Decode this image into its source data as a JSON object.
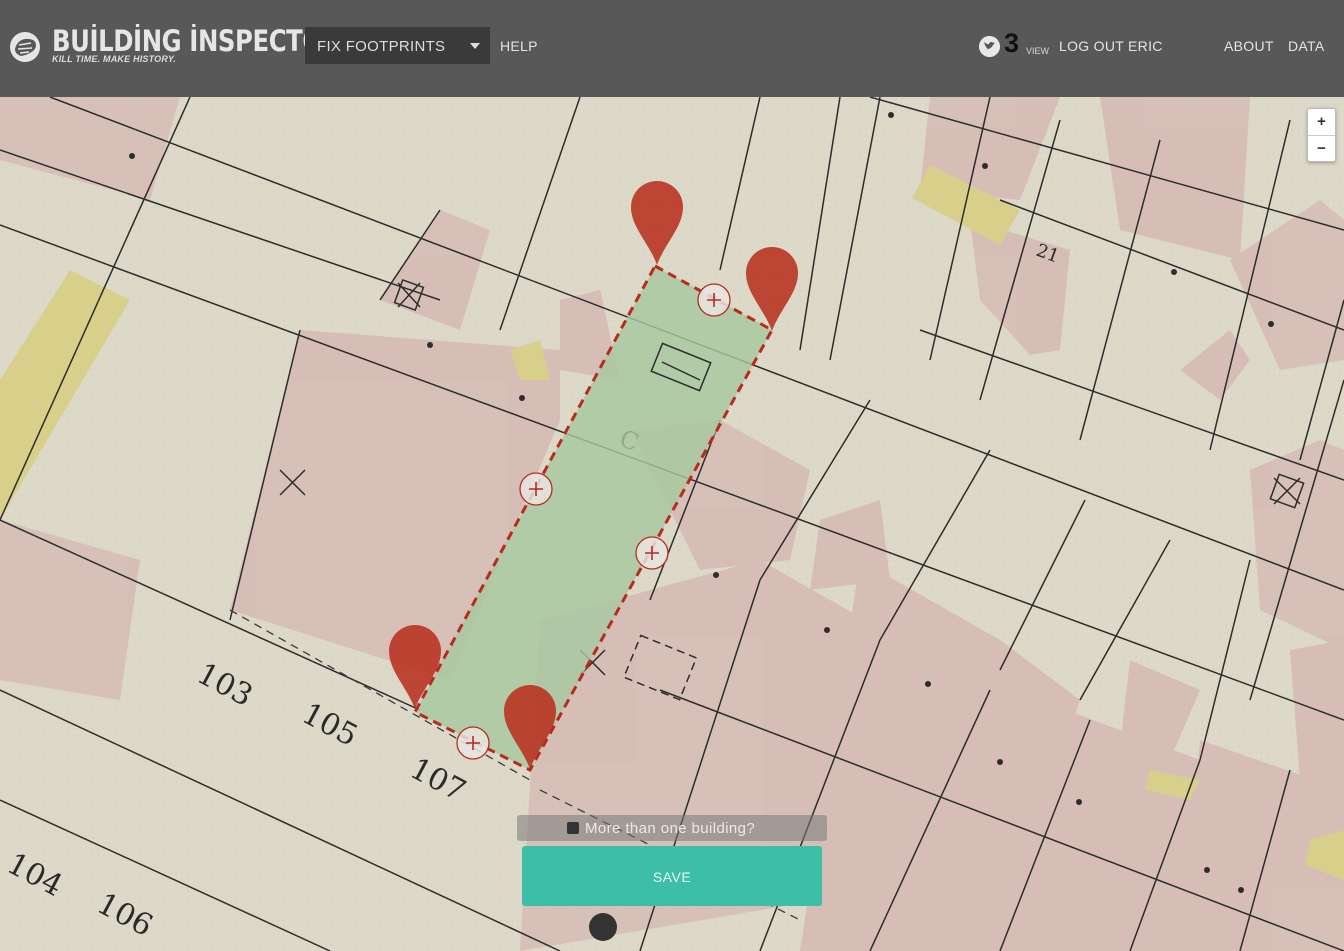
{
  "header": {
    "logo_title": "BUİLDİNG İNSPECTOR",
    "logo_tagline": "KILL TIME. MAKE HISTORY.",
    "task_selected": "FIX FOOTPRINTS",
    "help_label": "HELP",
    "score_count": "3",
    "score_view_label": "VIEW",
    "logout_label": "LOG OUT ERIC",
    "about_label": "ABOUT",
    "data_label": "DATA"
  },
  "map": {
    "zoom_in": "+",
    "zoom_out": "−",
    "polygon_color": "#c0392b",
    "footprint_fill": "#a8c8a0",
    "lot_numbers": [
      "103",
      "105",
      "107",
      "104",
      "106",
      "C",
      "21"
    ]
  },
  "controls": {
    "multi_building_label": "More than one building?",
    "save_label": "SAVE"
  },
  "colors": {
    "header_bg": "#585858",
    "save_button": "#3dbea9",
    "marker": "#c0392b"
  }
}
